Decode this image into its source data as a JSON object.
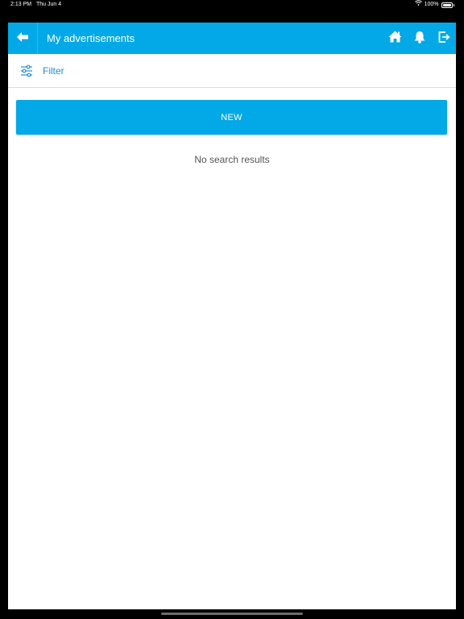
{
  "status_bar": {
    "time": "2:13 PM",
    "date": "Thu Jun 4",
    "battery": "100%",
    "icons": [
      "wifi-icon",
      "battery-icon"
    ]
  },
  "toolbar": {
    "title": "My advertisements",
    "back_icon": "arrow-left-icon",
    "icons": [
      "home-icon",
      "bell-icon",
      "logout-icon"
    ],
    "background": "#03a9e7"
  },
  "filter": {
    "label": "Filter",
    "icon": "sliders-icon",
    "color": "#1e8fd0"
  },
  "actions": {
    "new_label": "NEW"
  },
  "results": {
    "empty_message": "No search results"
  }
}
